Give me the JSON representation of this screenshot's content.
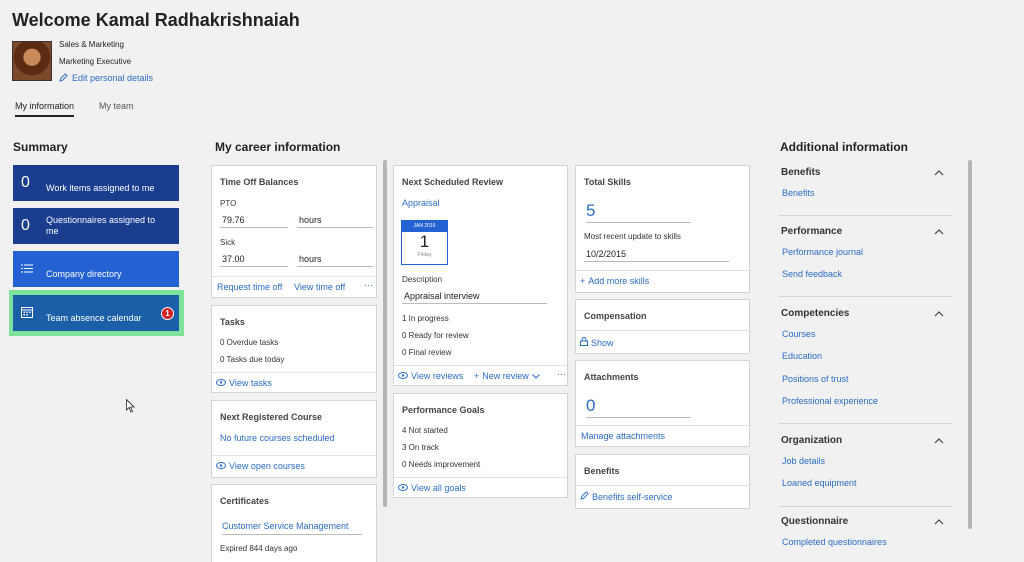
{
  "header": {
    "title": "Welcome Kamal Radhakrishnaiah",
    "department": "Sales & Marketing",
    "role": "Marketing Executive",
    "edit_label": "Edit personal details"
  },
  "tabs": [
    {
      "label": "My information",
      "active": true
    },
    {
      "label": "My team",
      "active": false
    }
  ],
  "summary": {
    "heading": "Summary",
    "tiles": [
      {
        "count": "0",
        "label": "Work items assigned to me"
      },
      {
        "count": "0",
        "label": "Questionnaires assigned to me"
      },
      {
        "label": "Company directory"
      },
      {
        "label": "Team absence calendar",
        "badge": "1"
      }
    ]
  },
  "career": {
    "heading": "My career information",
    "time_off": {
      "title": "Time Off Balances",
      "pto_label": "PTO",
      "pto_value": "79.76",
      "pto_unit": "hours",
      "sick_label": "Sick",
      "sick_value": "37.00",
      "sick_unit": "hours",
      "request_label": "Request time off",
      "view_label": "View time off",
      "more": "···"
    },
    "tasks": {
      "title": "Tasks",
      "overdue": "0 Overdue tasks",
      "due_today": "0 Tasks due today",
      "view_label": "View tasks"
    },
    "course": {
      "title": "Next Registered Course",
      "none": "No future courses scheduled",
      "view_label": "View open courses"
    },
    "certificates": {
      "title": "Certificates",
      "name": "Customer Service Management",
      "expired": "Expired 844 days ago"
    },
    "review": {
      "title": "Next Scheduled Review",
      "link": "Appraisal",
      "cal_month": "JAN 2016",
      "cal_day": "1",
      "cal_weekday": "Friday",
      "desc_label": "Description",
      "desc_value": "Appraisal interview",
      "in_progress": "1 In progress",
      "ready": "0 Ready for review",
      "final": "0 Final review",
      "view_label": "View reviews",
      "new_label": "New review",
      "more": "···"
    },
    "goals": {
      "title": "Performance Goals",
      "not_started": "4 Not started",
      "on_track": "3 On track",
      "needs": "0 Needs improvement",
      "view_label": "View all goals"
    },
    "skills": {
      "title": "Total Skills",
      "count": "5",
      "update_label": "Most recent update to skills",
      "update_value": "10/2/2015",
      "add_label": "Add more skills"
    },
    "compensation": {
      "title": "Compensation",
      "show_label": "Show"
    },
    "attachments": {
      "title": "Attachments",
      "count": "0",
      "manage_label": "Manage attachments"
    },
    "benefits": {
      "title": "Benefits",
      "link": "Benefits self-service"
    }
  },
  "additional": {
    "heading": "Additional information",
    "groups": [
      {
        "title": "Benefits",
        "links": [
          "Benefits"
        ]
      },
      {
        "title": "Performance",
        "links": [
          "Performance journal",
          "Send feedback"
        ]
      },
      {
        "title": "Competencies",
        "links": [
          "Courses",
          "Education",
          "Positions of trust",
          "Professional experience"
        ]
      },
      {
        "title": "Organization",
        "links": [
          "Job details",
          "Loaned equipment"
        ]
      },
      {
        "title": "Questionnaire",
        "links": [
          "Completed questionnaires"
        ]
      }
    ]
  },
  "colors": {
    "tile_dark": "#1b3d8f",
    "tile_blue": "#2462d4",
    "highlight": "#7ee29a",
    "badge": "#d32020",
    "link": "#2b6cc4"
  }
}
